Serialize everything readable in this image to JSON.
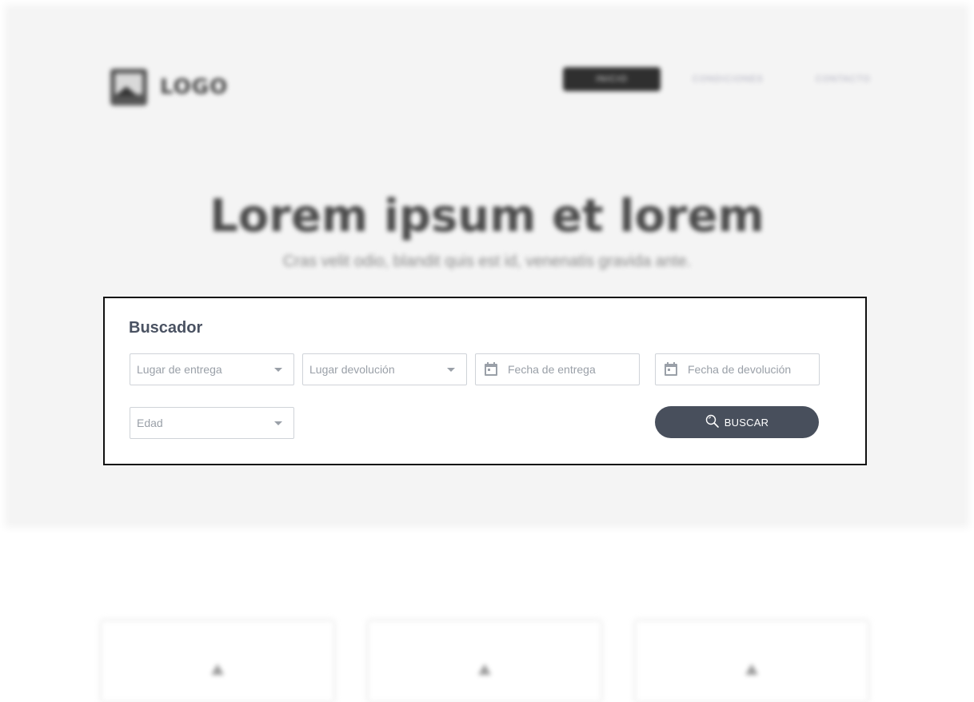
{
  "header": {
    "logo_text": "LOGO",
    "nav": [
      {
        "label": "Inicio"
      },
      {
        "label": "Condiciones"
      },
      {
        "label": "Contacto"
      }
    ]
  },
  "hero": {
    "title": "Lorem ipsum et lorem",
    "subtitle": "Cras velit odio, blandit quis est id, venenatis gravida ante."
  },
  "search_panel": {
    "title": "Buscador",
    "fields": {
      "pickup_location": {
        "placeholder": "Lugar de entrega",
        "value": ""
      },
      "return_location": {
        "placeholder": "Lugar devolución",
        "value": ""
      },
      "pickup_date": {
        "placeholder": "Fecha de entrega",
        "value": ""
      },
      "return_date": {
        "placeholder": "Fecha de devolución",
        "value": ""
      },
      "age": {
        "placeholder": "Edad",
        "value": ""
      }
    },
    "search_button": {
      "label": "BUSCAR",
      "icon": "search-icon"
    }
  },
  "cards": [
    {
      "icon": "image-icon"
    },
    {
      "icon": "image-icon"
    },
    {
      "icon": "image-icon"
    }
  ],
  "colors": {
    "hero_bg": "#f4f4f4",
    "panel_border": "#111111",
    "button_bg": "#484f5c",
    "title_text": "#4a5262",
    "placeholder_text": "#9aa0a8"
  }
}
